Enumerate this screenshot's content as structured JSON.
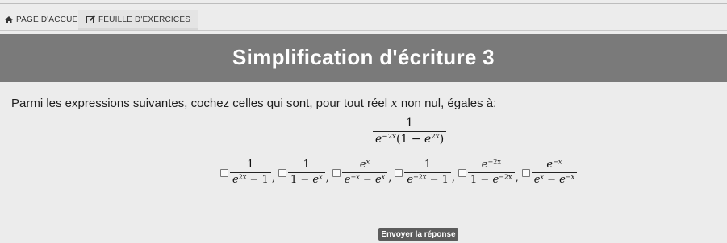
{
  "nav": {
    "home_label": "PAGE D'ACCUEIL",
    "home_icon": "home-icon",
    "sheet_label": "FEUILLE D'EXERCICES",
    "sheet_icon": "edit-icon"
  },
  "banner": {
    "title": "Simplification d'écriture 3",
    "color": "#7a7a7a"
  },
  "question": {
    "text_before": "Parmi les expressions suivantes, cochez celles qui sont, pour tout réel ",
    "variable": "x",
    "text_after": " non nul, égales à:"
  },
  "expression": {
    "numerator": "1",
    "denominator": "e^{-2x}(1 − e^{2x})"
  },
  "options": [
    {
      "numerator": "1",
      "denominator": "e^{2x} − 1",
      "checked": false
    },
    {
      "numerator": "1",
      "denominator": "1 − e^{x}",
      "checked": false
    },
    {
      "numerator": "e^{x}",
      "denominator": "e^{-x} − e^{x}",
      "checked": false
    },
    {
      "numerator": "1",
      "denominator": "e^{-2x} − 1",
      "checked": false
    },
    {
      "numerator": "e^{-2x}",
      "denominator": "1 − e^{-2x}",
      "checked": false
    },
    {
      "numerator": "e^{-x}",
      "denominator": "e^{x} − e^{-x}",
      "checked": false
    }
  ],
  "submit": {
    "label": "Envoyer la réponse"
  }
}
